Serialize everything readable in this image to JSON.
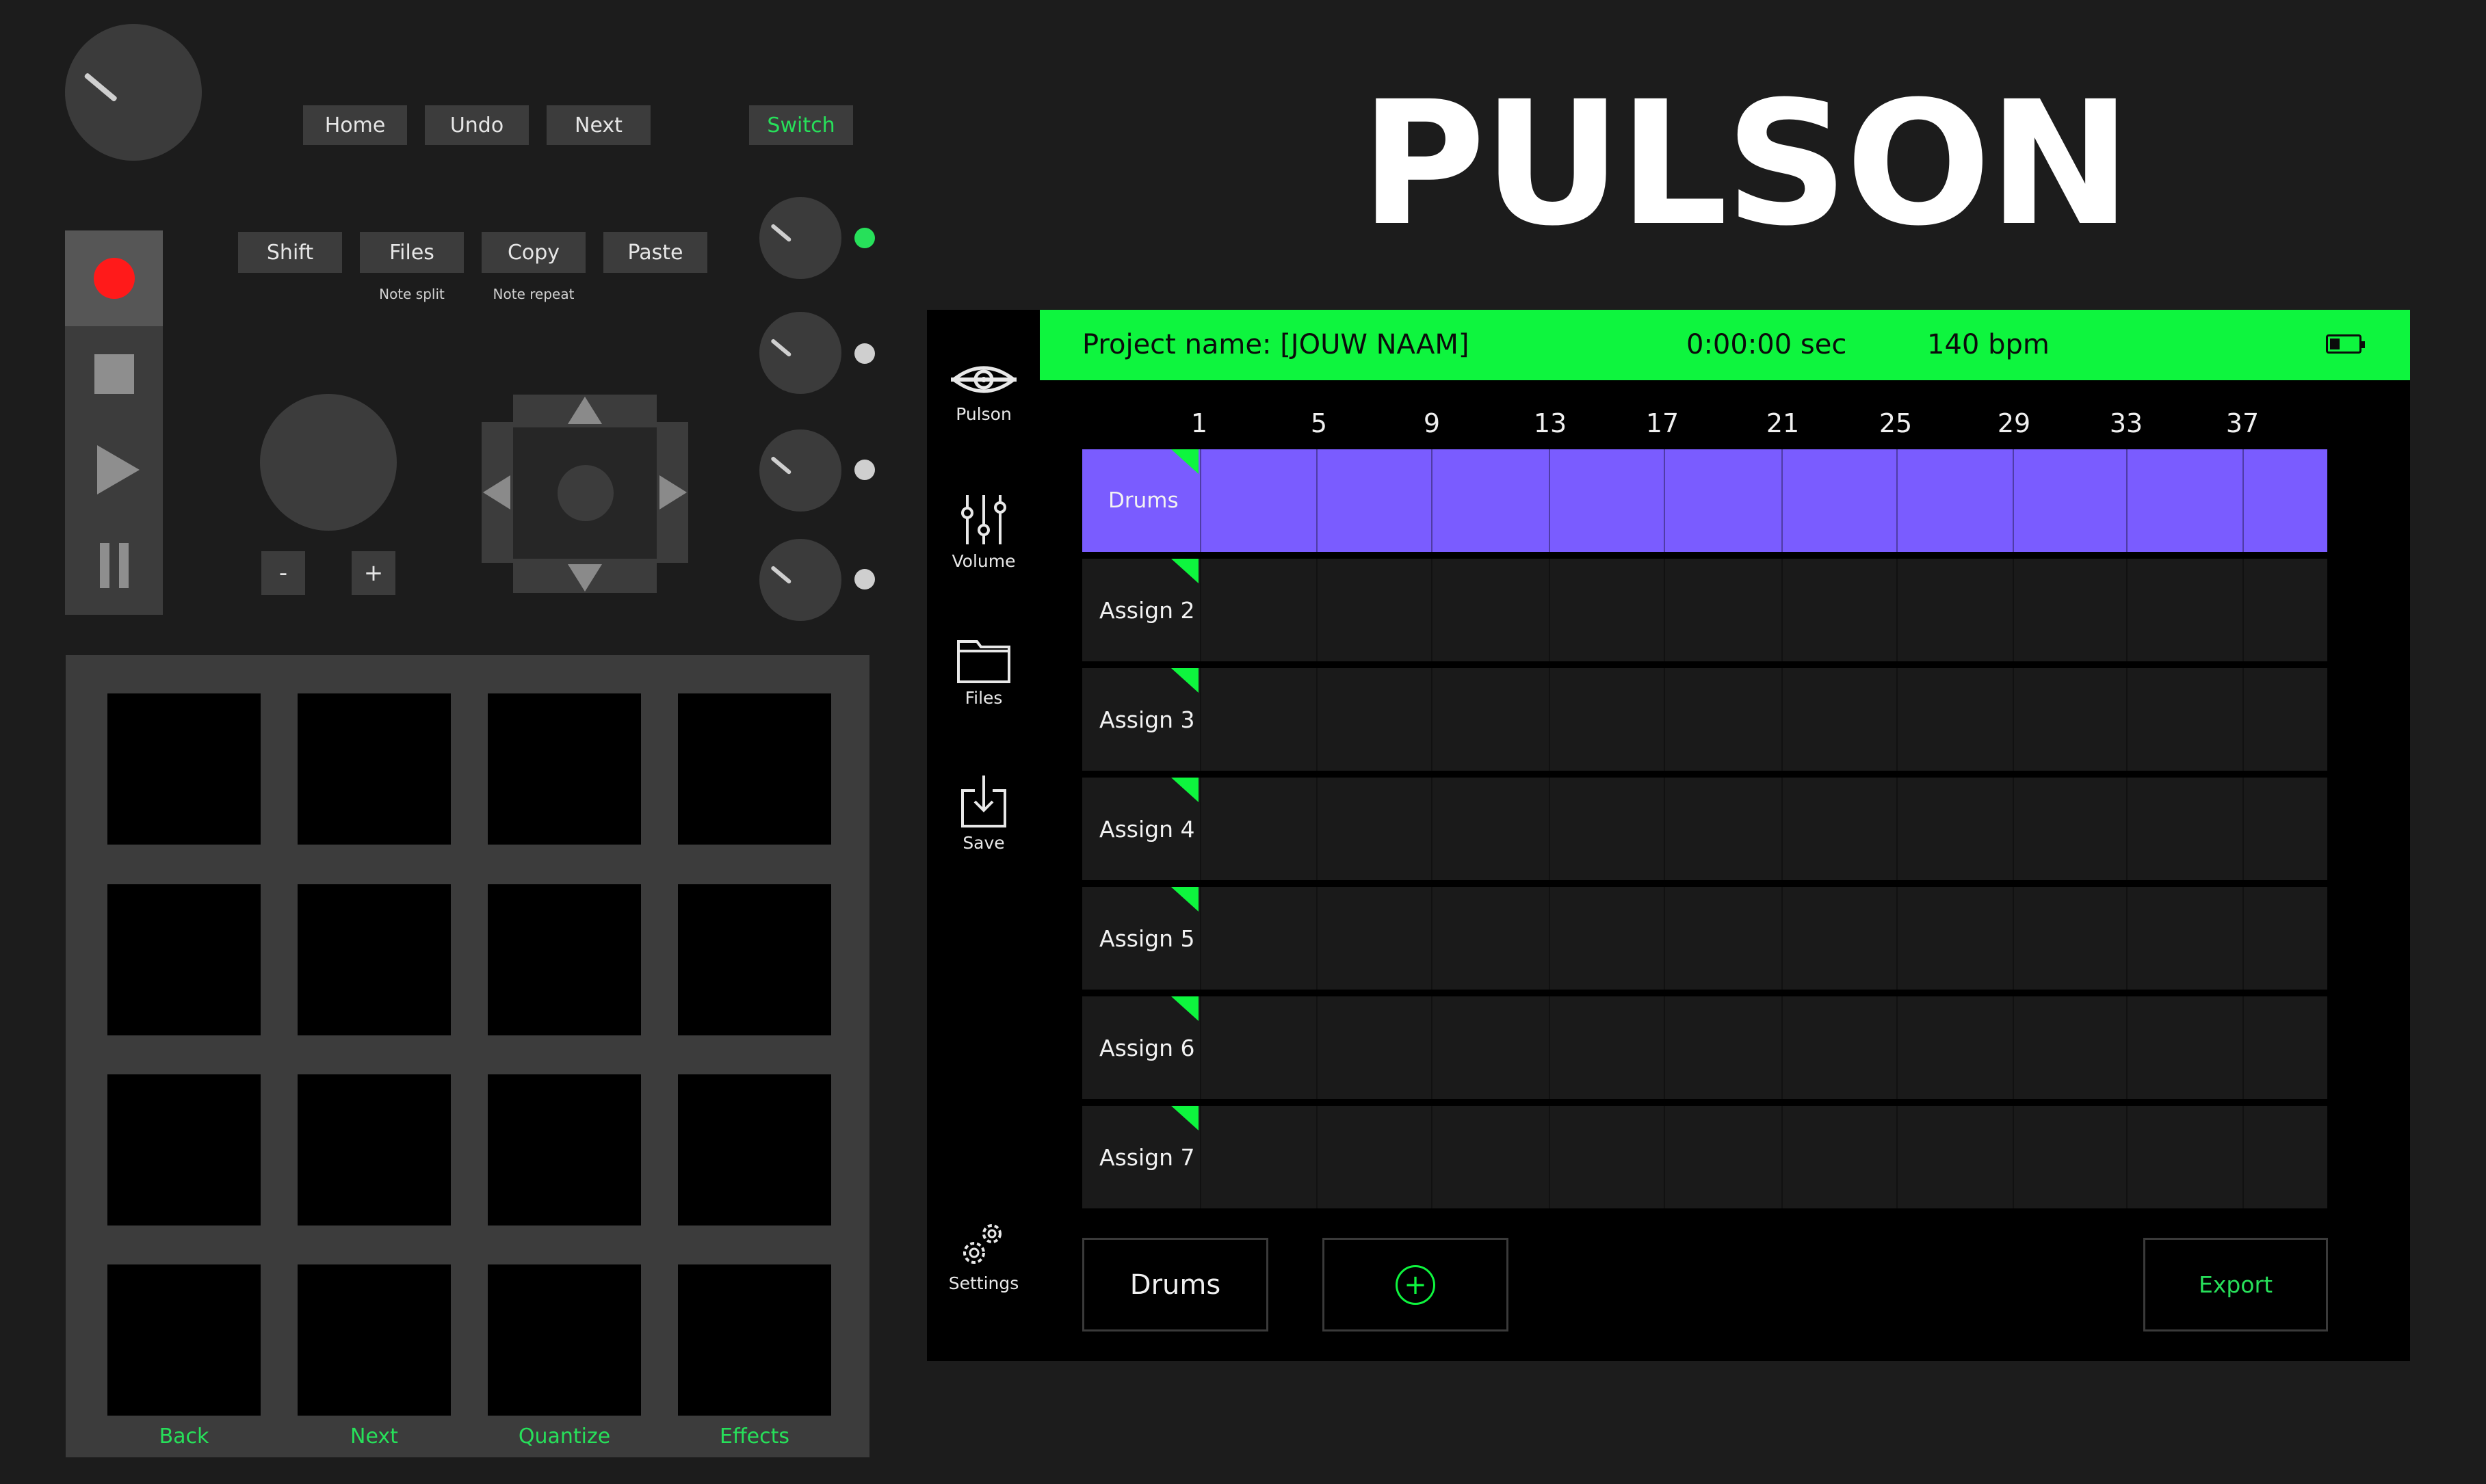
{
  "brand": {
    "title": "PULSON"
  },
  "controller": {
    "top_buttons": [
      "Home",
      "Undo",
      "Next"
    ],
    "switch_label": "Switch",
    "mid_buttons": [
      "Shift",
      "Files",
      "Copy",
      "Paste"
    ],
    "sublabels": {
      "files": "Note split",
      "copy": "Note repeat"
    },
    "zoom_minus": "-",
    "zoom_plus": "+",
    "pad_labels": [
      "Back",
      "Next",
      "Quantize",
      "Effects"
    ],
    "indicator_colors": {
      "active": "#27e05a",
      "inactive": "#cfcfcf"
    }
  },
  "screen": {
    "project_name": "Project name: [JOUW NAAM]",
    "time": "0:00:00 sec",
    "bpm": "140 bpm",
    "nav": [
      "Pulson",
      "Volume",
      "Files",
      "Save",
      "Settings"
    ],
    "grid_numbers": [
      "1",
      "5",
      "9",
      "13",
      "17",
      "21",
      "25",
      "29",
      "33",
      "37"
    ],
    "tracks": [
      "Drums",
      "Assign 2",
      "Assign 3",
      "Assign 4",
      "Assign 5",
      "Assign 6",
      "Assign 7"
    ],
    "bottom": {
      "instrument": "Drums",
      "add": "+",
      "export": "Export"
    },
    "colors": {
      "accent": "#0ef53e",
      "active_track": "#7a5cff"
    }
  }
}
